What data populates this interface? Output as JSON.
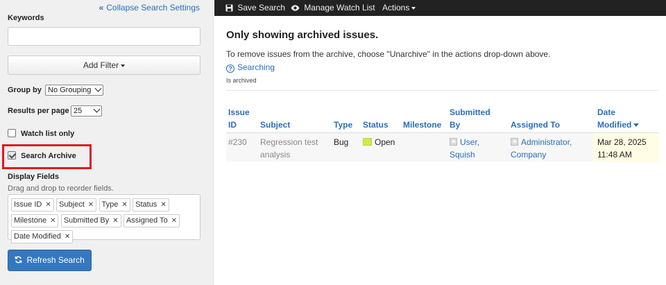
{
  "sidebar": {
    "collapse_label": "Collapse Search Settings",
    "keywords_label": "Keywords",
    "keywords_value": "",
    "add_filter_label": "Add Filter",
    "group_by_label": "Group by",
    "group_by_value": "No Grouping",
    "results_per_page_label": "Results per page",
    "results_per_page_value": "25",
    "watch_list_label": "Watch list only",
    "watch_list_checked": false,
    "search_archive_label": "Search Archive",
    "search_archive_checked": true,
    "display_fields_label": "Display Fields",
    "display_fields_hint": "Drag and drop to reorder fields.",
    "display_fields": [
      "Issue ID",
      "Subject",
      "Type",
      "Status",
      "Milestone",
      "Submitted By",
      "Assigned To",
      "Date Modified"
    ],
    "refresh_label": "Refresh Search"
  },
  "topbar": {
    "save_search": "Save Search",
    "manage_watch_list": "Manage Watch List",
    "actions": "Actions"
  },
  "main": {
    "title": "Only showing archived issues.",
    "description": "To remove issues from the archive, choose \"Unarchive\" in the actions drop-down above.",
    "searching_link": "Searching",
    "filter_note": "Is archived",
    "columns": {
      "issue_id_1": "Issue",
      "issue_id_2": "ID",
      "subject": "Subject",
      "type": "Type",
      "status": "Status",
      "milestone": "Milestone",
      "submitted_by_1": "Submitted",
      "submitted_by_2": "By",
      "assigned_to": "Assigned To",
      "date_modified_1": "Date",
      "date_modified_2": "Modified"
    },
    "rows": [
      {
        "issue_id": "#230",
        "subject_1": "Regression test",
        "subject_2": "analysis",
        "type": "Bug",
        "status": "Open",
        "status_color": "#c9ee4a",
        "milestone": "",
        "submitted_by_1": "User,",
        "submitted_by_2": "Squish",
        "assigned_to_1": "Administrator,",
        "assigned_to_2": "Company",
        "date_1": "Mar 28, 2025",
        "date_2": "11:48 AM"
      }
    ]
  },
  "colors": {
    "link": "#2a6ebb",
    "button_primary": "#3478c0",
    "highlight": "#e0191f",
    "topbar": "#222222"
  }
}
